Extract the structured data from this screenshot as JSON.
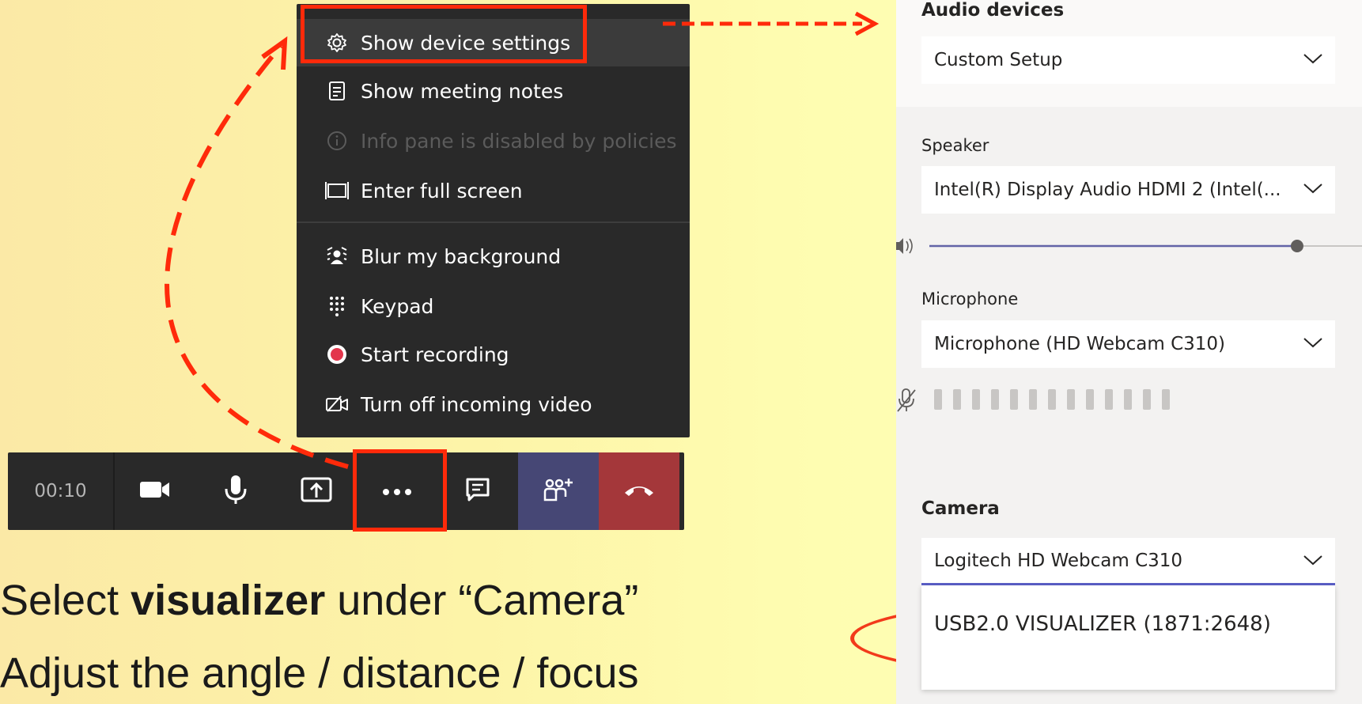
{
  "menu": {
    "items": [
      {
        "label": "Show device settings",
        "icon": "gear-icon",
        "state": "hover"
      },
      {
        "label": "Show meeting notes",
        "icon": "notes-icon",
        "state": "normal"
      },
      {
        "label": "Info pane is disabled by policies",
        "icon": "info-icon",
        "state": "disabled"
      },
      {
        "label": "Enter full screen",
        "icon": "fullscreen-icon",
        "state": "normal"
      },
      {
        "label": "Blur my background",
        "icon": "blur-background-icon",
        "state": "normal"
      },
      {
        "label": "Keypad",
        "icon": "keypad-icon",
        "state": "normal"
      },
      {
        "label": "Start recording",
        "icon": "record-icon",
        "state": "normal"
      },
      {
        "label": "Turn off incoming video",
        "icon": "video-off-icon",
        "state": "normal"
      }
    ]
  },
  "toolbar": {
    "timer": "00:10",
    "buttons": [
      "camera-icon",
      "microphone-icon",
      "share-screen-icon",
      "more-options-icon",
      "chat-icon",
      "people-icon",
      "hang-up-icon"
    ]
  },
  "slide": {
    "line1_prefix": "Select ",
    "line1_bold": "visualizer",
    "line1_suffix": " under “Camera”",
    "line2": "Adjust the angle / distance / focus"
  },
  "panel": {
    "audio_devices_label": "Audio devices",
    "audio_devices_value": "Custom Setup",
    "speaker_label": "Speaker",
    "speaker_value": "Intel(R) Display Audio HDMI 2 (Intel(...",
    "speaker_volume": 0.85,
    "microphone_label": "Microphone",
    "microphone_value": "Microphone (HD Webcam C310)",
    "mic_level_bars": 13,
    "camera_label": "Camera",
    "camera_value": "Logitech HD Webcam C310",
    "camera_option": "USB2.0 VISUALIZER (1871:2648)"
  },
  "colors": {
    "annotation_red": "#ff2a0a",
    "menu_bg": "#292929",
    "accent": "#5b5fc7",
    "hangup": "#a4373a",
    "people_button": "#464775"
  }
}
